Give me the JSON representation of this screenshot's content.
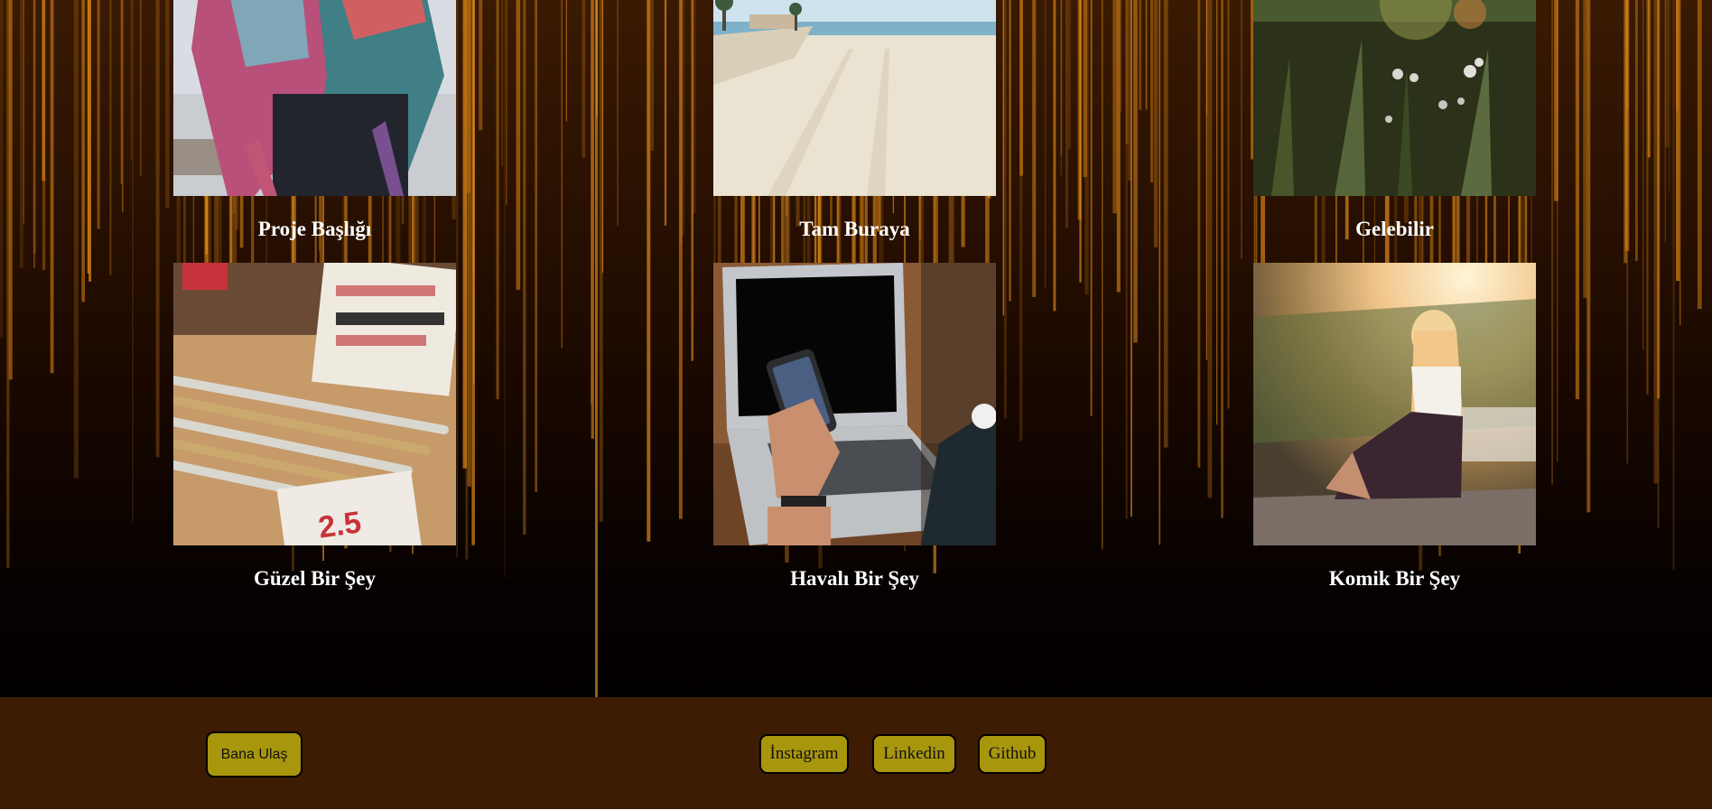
{
  "projects": [
    {
      "title": "Proje Başlığı",
      "image": "scarf-photo"
    },
    {
      "title": "Tam Buraya",
      "image": "beach-photo"
    },
    {
      "title": "Gelebilir",
      "image": "grass-photo"
    },
    {
      "title": "Güzel Bir Şey",
      "image": "rulers-photo"
    },
    {
      "title": "Havalı Bir Şey",
      "image": "laptop-phone-photo"
    },
    {
      "title": "Komik Bir Şey",
      "image": "woman-sunset-photo"
    }
  ],
  "footer": {
    "contact_label": "Bana Ulaş",
    "social": {
      "instagram": "İnstagram",
      "linkedin": "Linkedin",
      "github": "Github"
    }
  },
  "colors": {
    "footer_bg": "#3d1c03",
    "button_bg": "#a8960c",
    "streak": "#e8901a"
  }
}
